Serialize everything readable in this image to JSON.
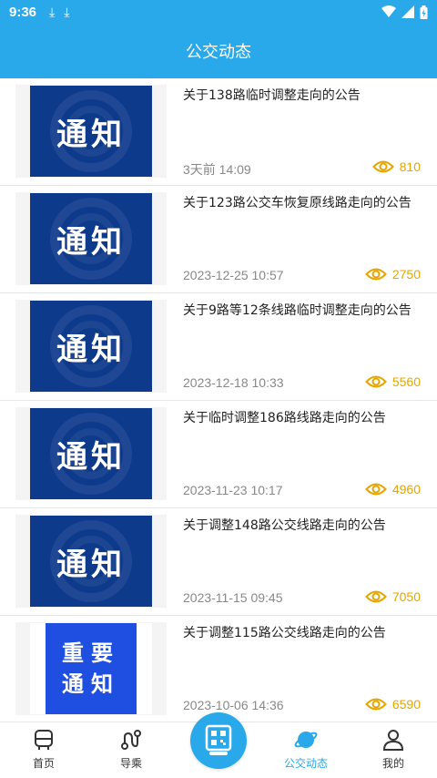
{
  "status_bar": {
    "time": "9:36"
  },
  "header": {
    "title": "公交动态"
  },
  "notices": [
    {
      "title": "关于138路临时调整走向的公告",
      "date": "3天前  14:09",
      "views": "810",
      "thumb": "通知"
    },
    {
      "title": "关于123路公交车恢复原线路走向的公告",
      "date": "2023-12-25 10:57",
      "views": "2750",
      "thumb": "通知"
    },
    {
      "title": "关于9路等12条线路临时调整走向的公告",
      "date": "2023-12-18 10:33",
      "views": "5560",
      "thumb": "通知"
    },
    {
      "title": "关于临时调整186路线路走向的公告",
      "date": "2023-11-23 10:17",
      "views": "4960",
      "thumb": "通知"
    },
    {
      "title": "关于调整148路公交线路走向的公告",
      "date": "2023-11-15 09:45",
      "views": "7050",
      "thumb": "通知"
    },
    {
      "title": "关于调整115路公交线路走向的公告",
      "date": "2023-10-06 14:36",
      "views": "6590",
      "thumb_line1": "重要",
      "thumb_line2": "通知"
    }
  ],
  "tabs": {
    "home": "首页",
    "guide": "导乘",
    "news": "公交动态",
    "mine": "我的"
  },
  "colors": {
    "primary": "#29a9ea",
    "views": "#e7a500",
    "notice_bg": "#0e3a8c",
    "important_bg": "#1f4fe0"
  }
}
